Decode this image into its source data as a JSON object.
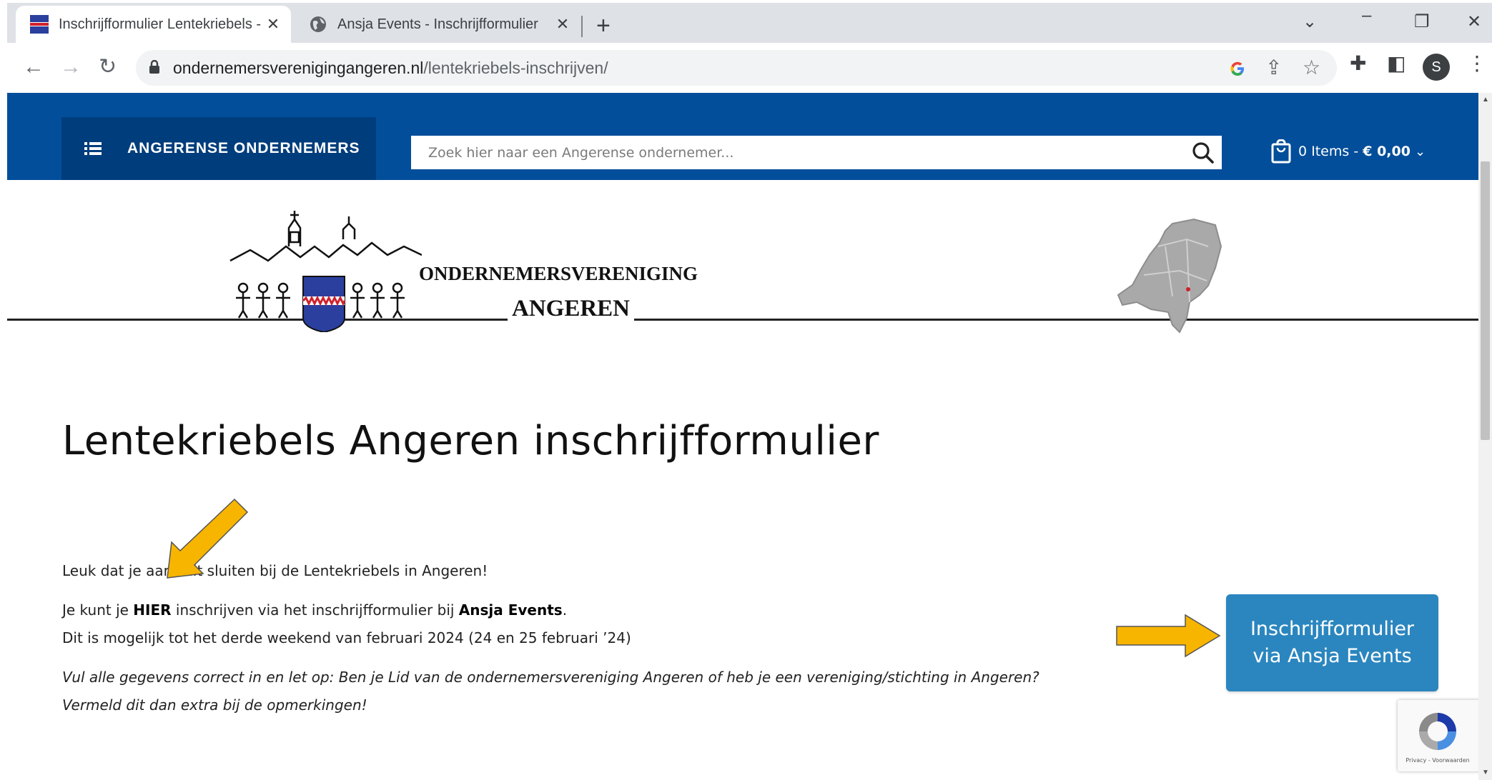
{
  "browser": {
    "tabs": [
      {
        "title": "Inschrijfformulier Lentekriebels -",
        "close": "✕"
      },
      {
        "title": "Ansja Events - Inschrijfformulier",
        "close": "✕"
      }
    ],
    "new_tab": "+",
    "url_domain": "ondernemersverenigingangeren.nl",
    "url_path": "/lentekriebels-inschrijven/",
    "profile_initial": "S"
  },
  "site": {
    "categories_label": "ANGERENSE ONDERNEMERS",
    "search_placeholder": "Zoek hier naar een Angerense ondernemer...",
    "cart_prefix": "0 Items - ",
    "cart_total": "€ 0,00",
    "cart_chevron": "⌄",
    "logo_line1": "ONDERNEMERSVERENIGING",
    "logo_line2": "ANGEREN"
  },
  "content": {
    "title": "Lentekriebels Angeren inschrijfformulier",
    "para1": "Leuk dat je aansluit sluiten bij de Lentekriebels in Angeren!",
    "para2_a": "Je kunt je ",
    "para2_b": "HIER",
    "para2_c": " inschrijven via het inschrijfformulier bij ",
    "para2_d": "Ansja Events",
    "para2_e": ".",
    "para3": "Dit is mogelijk tot het derde weekend van februari 2024 (24 en 25 februari ’24)",
    "para4": "Vul alle gegevens correct in en let op: Ben je Lid van de ondernemersvereniging Angeren of heb je een vereniging/stichting in Angeren?",
    "para5": "Vermeld dit dan extra bij de opmerkingen!",
    "cta_line1": "Inschrijfformulier",
    "cta_line2": "via Ansja Events"
  },
  "recaptcha": {
    "text": "Privacy - Voorwaarden"
  },
  "colors": {
    "header_blue": "#024e9a",
    "cta_blue": "#2b86bf",
    "arrow_yellow": "#f7b500"
  }
}
